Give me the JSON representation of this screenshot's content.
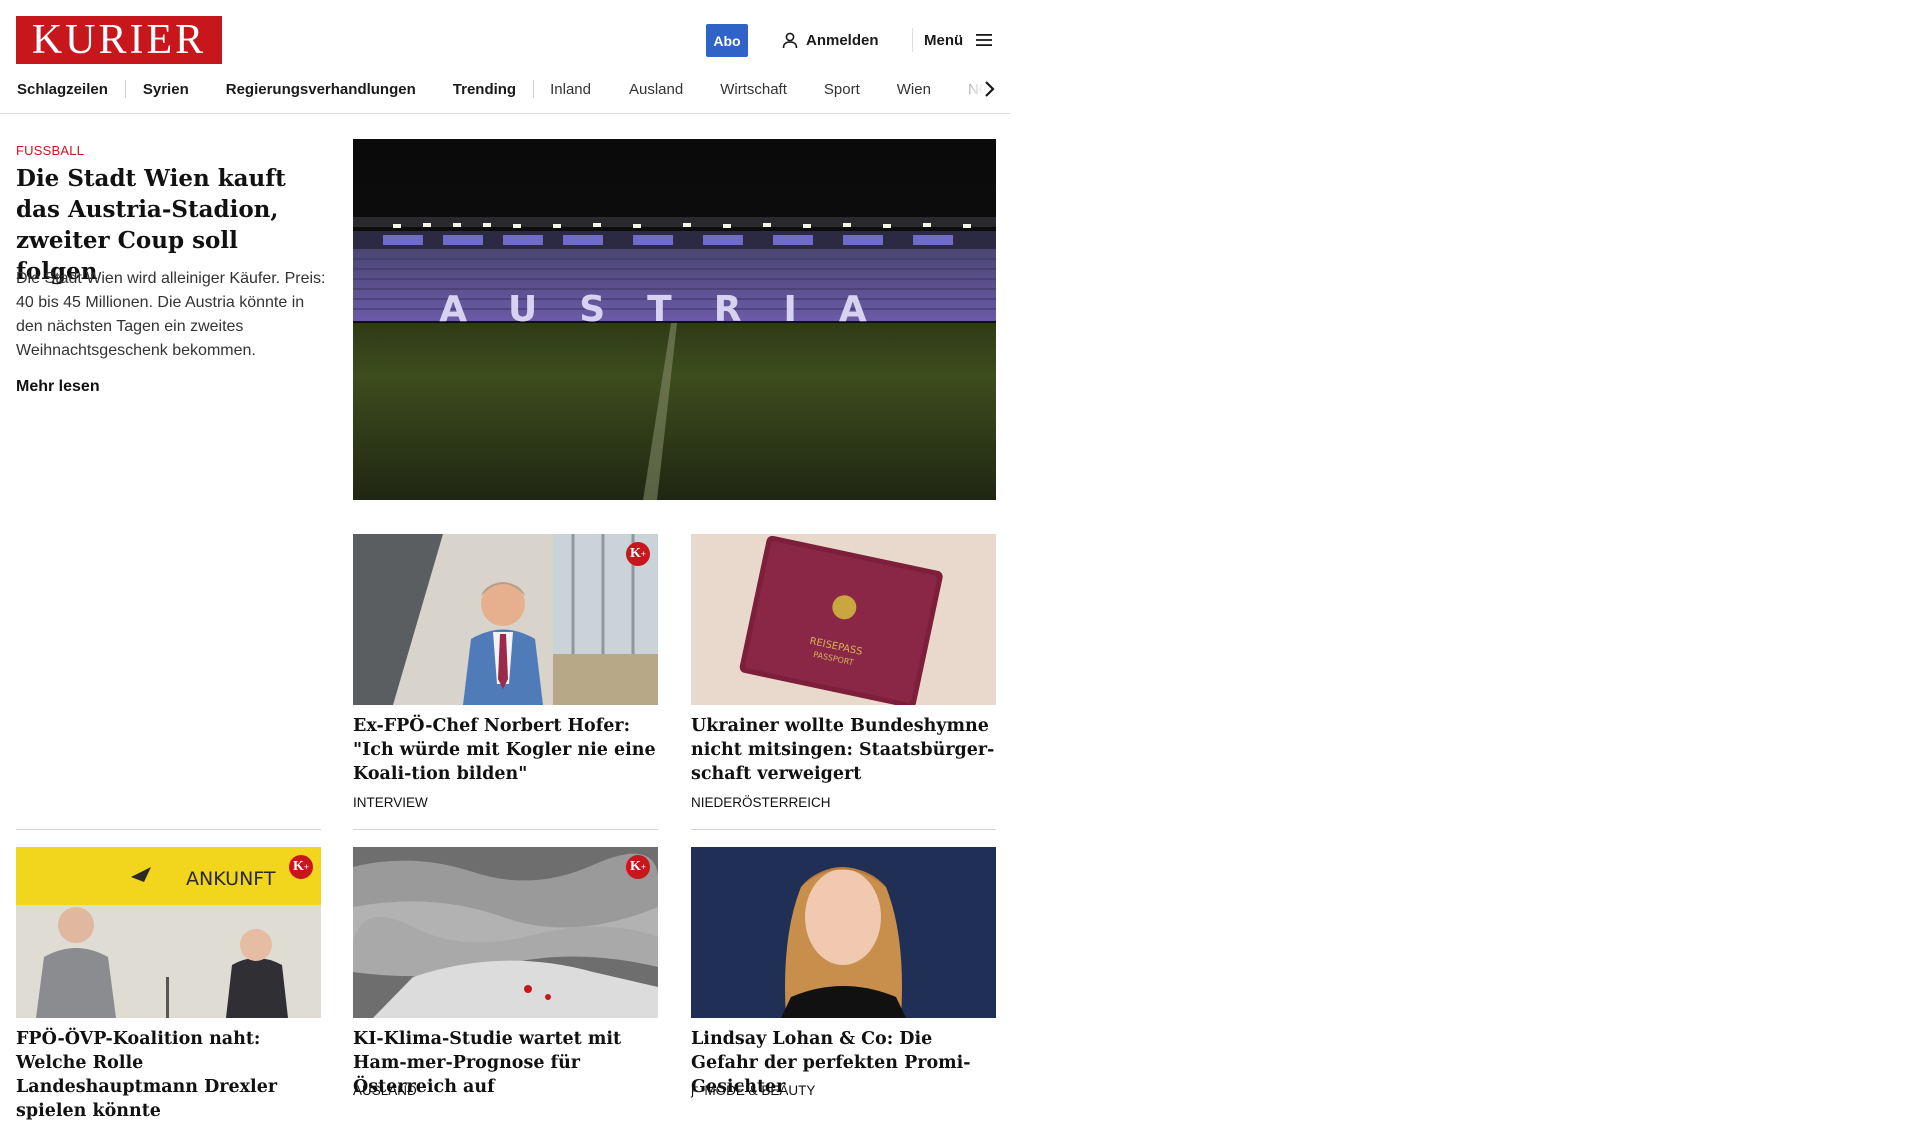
{
  "header": {
    "logo": "KURIER",
    "abo": "Abo",
    "login": "Anmelden",
    "menu": "Menü"
  },
  "nav": {
    "items": [
      "Schlagzeilen",
      "Syrien",
      "Regierungsverhandlungen",
      "Trending",
      "Inland",
      "Ausland",
      "Wirtschaft",
      "Sport",
      "Wien",
      "NÖ"
    ]
  },
  "lead": {
    "kicker": "FUSSBALL",
    "title": "Die Stadt Wien kauft das Austria-Stadion, zweiter Coup soll folgen",
    "text": "Die Stadt Wien wird alleiniger Käufer. Preis: 40 bis 45 Millionen. Die Austria könnte in den nächsten Tagen ein zweites Weihnachtsgeschenk bekommen.",
    "more": "Mehr lesen",
    "stadium_lettering": "AUSTRIA"
  },
  "cards": [
    {
      "title": "Ex-FPÖ-Chef Norbert Hofer: \"Ich würde mit Kogler nie eine Koali-tion bilden\"",
      "kicker": "INTERVIEW",
      "premium": true
    },
    {
      "title": "Ukrainer wollte Bundeshymne nicht mitsingen: Staatsbürger-schaft verweigert",
      "kicker": "NIEDERÖSTERREICH",
      "premium": false,
      "passport_text": "REISEPASS",
      "passport_sub": "PASSPORT"
    },
    {
      "title": "FPÖ-ÖVP-Koalition naht: Welche Rolle Landeshauptmann Drexler spielen könnte",
      "kicker": "",
      "premium": true,
      "sign_text": "ANKUNFT"
    },
    {
      "title": "KI-Klima-Studie wartet mit Ham-mer-Prognose für Österreich auf",
      "kicker": "AUSLAND",
      "premium": true
    },
    {
      "title": "Lindsay Lohan & Co: Die Gefahr der perfekten Promi-Gesichter",
      "kicker": "MODE & BEAUTY",
      "premium": false
    }
  ],
  "colors": {
    "brand": "#c8161d",
    "abo": "#2f63c7"
  }
}
